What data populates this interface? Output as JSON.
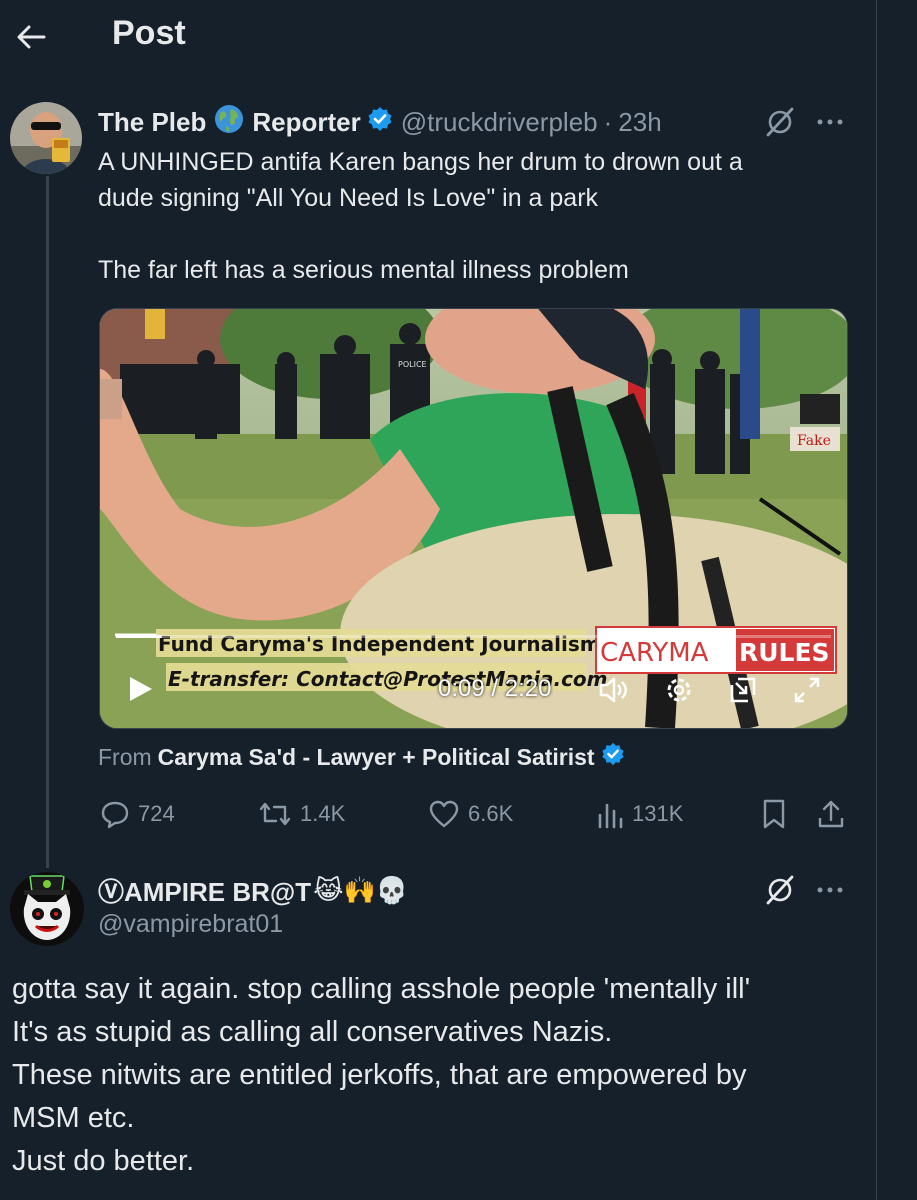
{
  "header": {
    "title": "Post"
  },
  "post": {
    "author_name_1": "The Pleb",
    "author_name_2": "Reporter",
    "handle": "@truckdriverpleb",
    "separator": "·",
    "time": "23h",
    "text_line1": "A UNHINGED antifa Karen bangs her drum to drown out a",
    "text_line2": "dude signing \"All You Need Is Love\" in a park",
    "text_line3": "The far left has a serious mental illness problem",
    "from_label": "From",
    "from_source": "Caryma Sa'd - Lawyer + Political Satirist",
    "stats": {
      "replies": "724",
      "reposts": "1.4K",
      "likes": "6.6K",
      "views": "131K"
    }
  },
  "video": {
    "banner_line1": "Fund Caryma's Independent Journalism",
    "banner_line2": "E-transfer: Contact@ProtestMania.com",
    "brand_part1": "CARYMA",
    "brand_part2": "RULES",
    "sign_text": "Fake",
    "police_label": "POLICE",
    "time_display": "0:09 / 2:20",
    "progress": 0.064
  },
  "reply": {
    "name": "ⓋAMPIRE BR@T",
    "emojis": "😹🙌💀",
    "handle": "@vampirebrat01",
    "line1": "gotta say it again. stop calling asshole people 'mentally ill'",
    "line2": "It's as stupid as calling all conservatives Nazis.",
    "line3": "These nitwits are entitled jerkoffs, that are empowered by",
    "line4": "MSM etc.",
    "line5": "Just do better."
  },
  "colors": {
    "background": "#15202b",
    "text": "#e7e9ea",
    "muted": "#8b98a5",
    "verified": "#1d9bf0",
    "border": "#38444d"
  }
}
